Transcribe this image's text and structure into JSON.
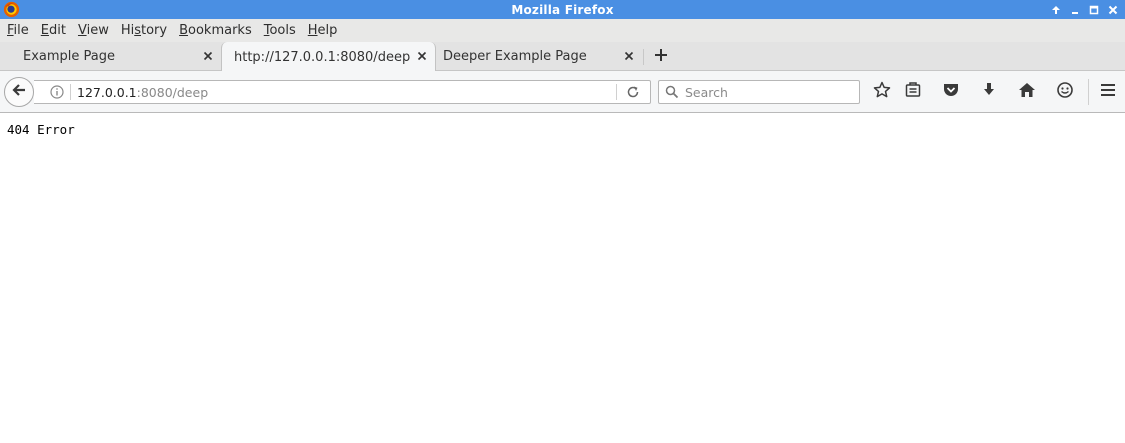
{
  "window": {
    "title": "Mozilla Firefox"
  },
  "menu": {
    "items": [
      {
        "mnemonic": "F",
        "rest": "ile"
      },
      {
        "mnemonic": "E",
        "rest": "dit"
      },
      {
        "mnemonic": "V",
        "rest": "iew"
      },
      {
        "pre": "Hi",
        "mnemonic": "s",
        "rest": "tory"
      },
      {
        "mnemonic": "B",
        "rest": "ookmarks"
      },
      {
        "mnemonic": "T",
        "rest": "ools"
      },
      {
        "mnemonic": "H",
        "rest": "elp"
      }
    ]
  },
  "tabs": [
    {
      "label": "Example Page",
      "active": false
    },
    {
      "label": "http://127.0.0.1:8080/deep",
      "active": true
    },
    {
      "label": "Deeper Example Page",
      "active": false
    }
  ],
  "navbar": {
    "url_host": "127.0.0.1",
    "url_rest": ":8080/deep",
    "search_placeholder": "Search"
  },
  "page": {
    "body_text": "404 Error"
  },
  "colors": {
    "titlebar": "#4a8fe3",
    "menubar": "#e8e8e7",
    "tabstrip": "#e3e3e3",
    "toolbar": "#f5f6f7"
  },
  "icons": {
    "app": "firefox-logo-icon",
    "titlebar_controls": [
      "window-up-icon",
      "window-minimize-icon",
      "window-maximize-icon",
      "window-close-icon"
    ],
    "toolbar": [
      "star-icon",
      "reading-list-icon",
      "pocket-icon",
      "download-icon",
      "home-icon",
      "smiley-icon",
      "hamburger-menu-icon"
    ]
  }
}
